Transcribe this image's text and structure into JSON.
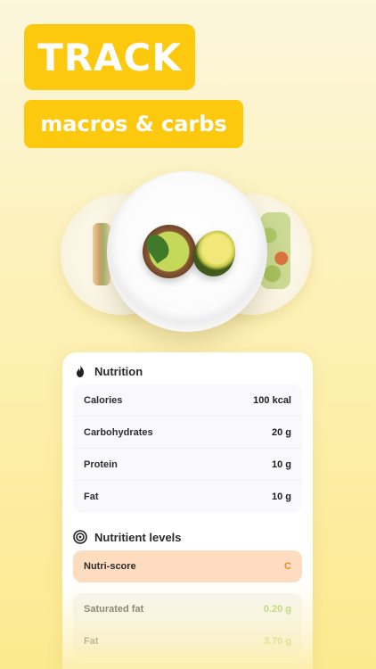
{
  "headline": "TRACK",
  "subheadline": "macros & carbs",
  "nutrition": {
    "title": "Nutrition",
    "rows": [
      {
        "name": "Calories",
        "value": "100 kcal"
      },
      {
        "name": "Carbohydrates",
        "value": "20 g"
      },
      {
        "name": "Protein",
        "value": "10 g"
      },
      {
        "name": "Fat",
        "value": "10 g"
      }
    ]
  },
  "levels": {
    "title": "Nutritient levels",
    "nutri_score": {
      "name": "Nutri-score",
      "grade": "C"
    },
    "rows": [
      {
        "name": "Saturated fat",
        "value": "0.20 g"
      },
      {
        "name": "Fat",
        "value": "3.70 g"
      }
    ]
  },
  "colors": {
    "accent": "#fdc90f",
    "nutri_highlight": "#fddcc0",
    "grade": "#f08a24",
    "good_value": "#8cc63f"
  },
  "icons": {
    "nutrition": "flame-icon",
    "levels": "target-icon"
  }
}
